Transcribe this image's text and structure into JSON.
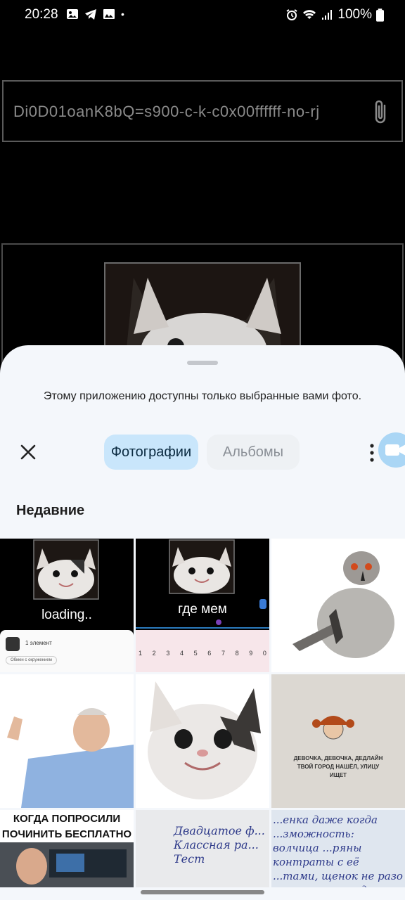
{
  "status_bar": {
    "time": "20:28",
    "battery": "100%",
    "dot": "•"
  },
  "url_field": {
    "value": "Di0D01oanK8bQ=s900-c-k-c0x00ffffff-no-rj"
  },
  "sheet": {
    "notice": "Этому приложению доступны только выбранные вами фото.",
    "tabs": {
      "photos": "Фотографии",
      "albums": "Альбомы"
    },
    "section_title": "Недавние"
  },
  "grid": {
    "cell1_caption": "loading..",
    "cell1_item_label": "1 элемент",
    "cell1_chip": "Обмен с окружением",
    "cell2_caption": "где мем",
    "cell2_keys": [
      "1",
      "2",
      "3",
      "4",
      "5",
      "6",
      "7",
      "8",
      "9",
      "0"
    ],
    "cell6_note": "ДЕВОЧКА, ДЕВОЧКА, ДЕДЛАЙН ТВОЙ ГОРОД НАШЁЛ, УЛИЦУ ИЩЕТ",
    "cell7_line1": "КОГДА ПОПРОСИЛИ",
    "cell7_line2": "ПОЧИНИТЬ БЕСПЛАТНО",
    "cell8_handwriting": "Двадцатое ф... Классная ра... Тест",
    "cell9_handwriting": "...енка даже когда ...зможность: волчица ...ряны контраты с её ...тами, щенок не разо ...а волчица когда оне"
  },
  "colors": {
    "accent": "#c9e6fb",
    "sheet_bg": "#f4f7fb"
  }
}
